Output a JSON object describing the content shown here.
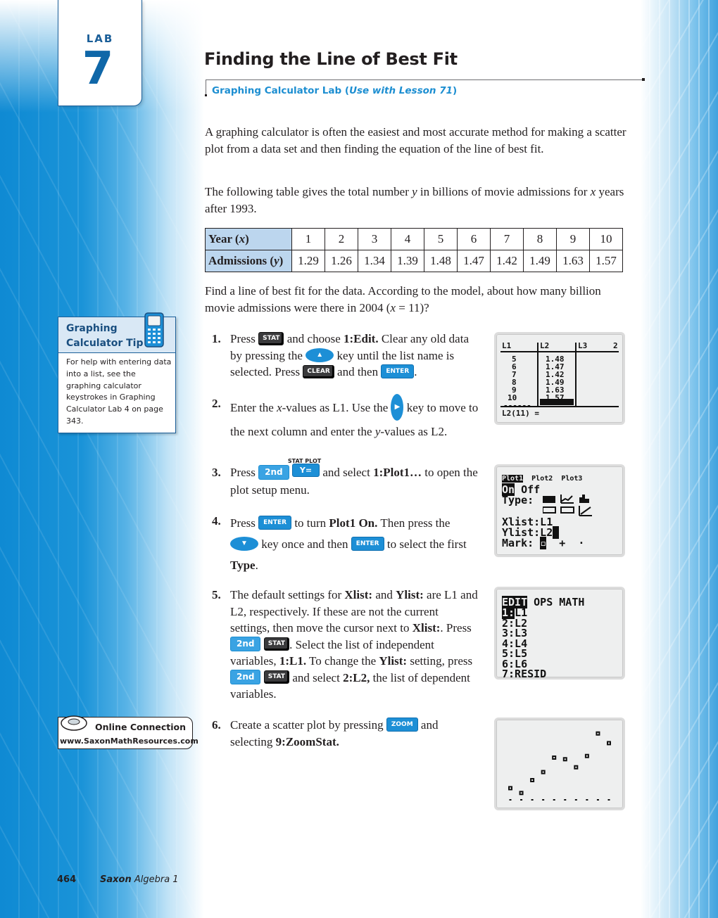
{
  "header": {
    "lab_word": "LAB",
    "lab_number": "7",
    "title": "Finding the Line of Best Fit",
    "subtitle_prefix": "Graphing Calculator Lab (",
    "subtitle_italic": "Use with Lesson 71",
    "subtitle_suffix": ")"
  },
  "intro": {
    "paragraph1": "A graphing calculator is often the easiest and most accurate method for making a scatter plot from a data set and then finding the equation of the line of best fit.",
    "paragraph2_a": "The following table gives the total number ",
    "paragraph2_var_y": "y",
    "paragraph2_b": " in billions of movie admissions for ",
    "paragraph2_var_x": "x",
    "paragraph2_c": " years after 1993."
  },
  "table": {
    "row_labels": [
      {
        "text": "Year (",
        "var": "x",
        "close": ")"
      },
      {
        "text": "Admissions (",
        "var": "y",
        "close": ")"
      }
    ],
    "years": [
      "1",
      "2",
      "3",
      "4",
      "5",
      "6",
      "7",
      "8",
      "9",
      "10"
    ],
    "admissions": [
      "1.29",
      "1.26",
      "1.34",
      "1.39",
      "1.48",
      "1.47",
      "1.42",
      "1.49",
      "1.63",
      "1.57"
    ]
  },
  "question": {
    "a": "Find a line of best fit for the data. According to the model, about how many billion movie admissions were there in 2004 (",
    "var": "x",
    "b": " = 11)?"
  },
  "tip": {
    "title_line1": "Graphing",
    "title_line2": "Calculator Tip",
    "body": "For help with entering data into a list, see the graphing calculator keystrokes in Graphing Calculator Lab 4 on page 343.",
    "icon": "calculator-icon"
  },
  "keys": {
    "stat": "STAT",
    "clear": "CLEAR",
    "enter": "ENTER",
    "second": "2nd",
    "yeq": "Y=",
    "stat_plot": "STAT PLOT",
    "zoom": "ZOOM",
    "up_arrow": "▲",
    "down_arrow": "▼",
    "right_arrow": "▶"
  },
  "steps": [
    {
      "num": "1.",
      "t1": "Press ",
      "t2": " and choose ",
      "b1": "1:Edit.",
      "t3": " Clear any old data by pressing the ",
      "t4": " key until the list name is selected. Press ",
      "t5": " and then ",
      "t6": "."
    },
    {
      "num": "2.",
      "t1": "Enter the ",
      "i1": "x",
      "t2": "-values as L1. Use the ",
      "t3": " key to move to the next column and enter the ",
      "i2": "y",
      "t4": "-values as L2."
    },
    {
      "num": "3.",
      "t1": "Press ",
      "t2": " and select ",
      "b1": "1:Plot1…",
      "t3": " to open the plot setup menu."
    },
    {
      "num": "4.",
      "t1": "Press ",
      "t2": " to turn ",
      "b1": "Plot1 On.",
      "t3": " Then press the ",
      "t4": " key once and then ",
      "t5": " to select the first ",
      "b2": "Type",
      "t6": "."
    },
    {
      "num": "5.",
      "t1": "The default settings for ",
      "b1": "Xlist:",
      "t2": " and ",
      "b2": "Ylist:",
      "t3": " are L1 and L2, respectively. If these are not the current settings, then move the cursor next to ",
      "b3": "Xlist:",
      "t4": ". Press ",
      "t5": ". Select the list of independent variables, ",
      "b4": "1:L1.",
      "t6": " To change the ",
      "b5": "Ylist:",
      "t7": " setting, press ",
      "t8": " and select ",
      "b6": "2:L2,",
      "t9": " the list of dependent variables."
    },
    {
      "num": "6.",
      "t1": "Create a scatter plot by pressing ",
      "t2": " and selecting ",
      "b1": "9:ZoomStat."
    }
  ],
  "screen1": {
    "headers": [
      "L1",
      "L2",
      "L3",
      "2"
    ],
    "l1": [
      "5",
      "6",
      "7",
      "8",
      "9",
      "10",
      "------"
    ],
    "l2": [
      "1.48",
      "1.47",
      "1.42",
      "1.49",
      "1.63",
      "1.57"
    ],
    "footer": "L2(11) ="
  },
  "screen2": {
    "tabs": [
      "Plot1",
      "Plot2",
      "Plot3"
    ],
    "on": "On",
    "off": "Off",
    "type_label": "Type:",
    "xlist": "Xlist:L1",
    "ylist": "Ylist:L2",
    "mark_label": "Mark:",
    "marks": [
      "▫",
      "+",
      "·"
    ]
  },
  "screen3": {
    "tabs": [
      "EDIT",
      "OPS",
      "MATH"
    ],
    "items": [
      "1:L1",
      "2:L2",
      "3:L3",
      "4:L4",
      "5:L5",
      "6:L6",
      "7:RESID"
    ]
  },
  "chart_data": {
    "type": "scatter",
    "title": "",
    "x": [
      1,
      2,
      3,
      4,
      5,
      6,
      7,
      8,
      9,
      10
    ],
    "y": [
      1.29,
      1.26,
      1.34,
      1.39,
      1.48,
      1.47,
      1.42,
      1.49,
      1.63,
      1.57
    ],
    "xlim": [
      0.1,
      10.9
    ],
    "ylim": [
      1.2,
      1.69
    ],
    "xlabel": "",
    "ylabel": "",
    "grid": false,
    "x_ticks": [
      1,
      2,
      3,
      4,
      5,
      6,
      7,
      8,
      9,
      10
    ]
  },
  "online": {
    "title": "Online Connection",
    "url": "www.SaxonMathResources.com"
  },
  "footer": {
    "page": "464",
    "book_bold": "Saxon",
    "book_rest": " Algebra 1"
  }
}
